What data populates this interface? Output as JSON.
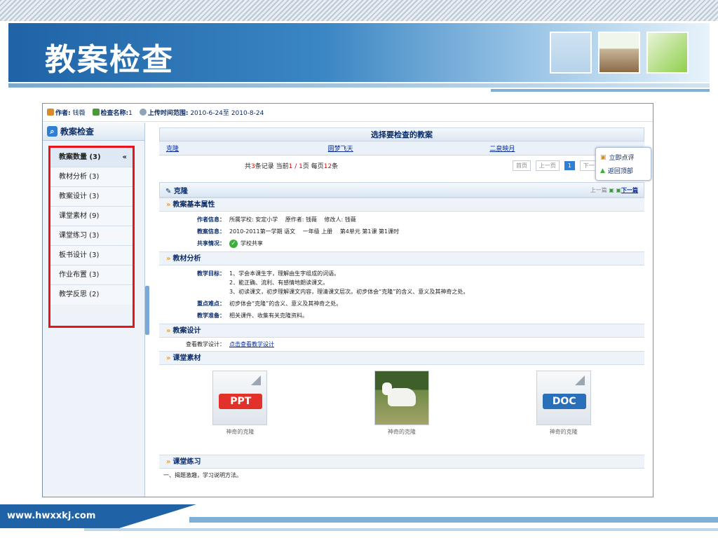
{
  "slide": {
    "title": "教案检查",
    "footer_url": "www.hwxxkj.com"
  },
  "infobar": {
    "author_label": "作者:",
    "author_value": "钱薇",
    "check_label": "检查名称:",
    "check_value": "1",
    "range_label": "上传时间范围:",
    "range_value": "2010-6-24至 2010-8-24"
  },
  "sidebar": {
    "title": "教案检查",
    "collapse": "«",
    "items": [
      {
        "label": "教案数量 (3)"
      },
      {
        "label": "教材分析 (3)"
      },
      {
        "label": "教案设计 (3)"
      },
      {
        "label": "课堂素材 (9)"
      },
      {
        "label": "课堂练习 (3)"
      },
      {
        "label": "板书设计 (3)"
      },
      {
        "label": "作业布置 (3)"
      },
      {
        "label": "教学反思 (2)"
      }
    ]
  },
  "selector": {
    "header": "选择要检查的教案",
    "lessons": [
      "克隆",
      "圆梦飞天",
      "二泉映月"
    ],
    "records_a": "共",
    "records_n": "3",
    "records_b": "条记录 当前",
    "records_cur": "1 / 1",
    "records_c": "页 每页",
    "records_per": "12",
    "records_d": "条",
    "first": "首页",
    "prev": "上一页",
    "page": "1",
    "next": "下一"
  },
  "popup": {
    "comment": "立即点评",
    "back_top": "返回顶部"
  },
  "doc": {
    "title": "克隆",
    "prev": "上一篇",
    "next": "下一篇",
    "sec_basic": "教案基本属性",
    "author_k": "作者信息：",
    "author_v": "所属学校: 安定小学　 原作者: 钱薇　 修改人: 钱薇",
    "plan_k": "教案信息：",
    "plan_v": "2010-2011第一学期 语文　 一年级 上册　 第4单元 第1课 第1课时",
    "share_k": "共享情况：",
    "share_v": "学校共享",
    "sec_analysis": "教材分析",
    "goal_k": "教学目标：",
    "goal_1": "1、学会本课生字，理解由生字组成的词语。",
    "goal_2": "2．能正确、流利、有感情地朗读课文。",
    "goal_3": "3、初读课文，初步理解课文内容，理清课文层次。初步体会“克隆”的含义、意义及其神奇之处。",
    "key_k": "重点难点：",
    "key_v": "初步体会“克隆”的含义、意义及其神奇之处。",
    "prep_k": "教学准备：",
    "prep_v": "相关课件、收集有关克隆资料。",
    "sec_design": "教案设计",
    "design_k": "查看教学设计：",
    "design_v": "点击查看教学设计",
    "sec_material": "课堂素材",
    "materials": [
      {
        "tag": "PPT",
        "caption": "神奇的克隆"
      },
      {
        "caption": "神奇的克隆"
      },
      {
        "tag": "DOC",
        "caption": "神奇的克隆"
      }
    ],
    "sec_exercise": "课堂练习",
    "exercise_line": "一、揭题激趣，学习说明方法。"
  }
}
